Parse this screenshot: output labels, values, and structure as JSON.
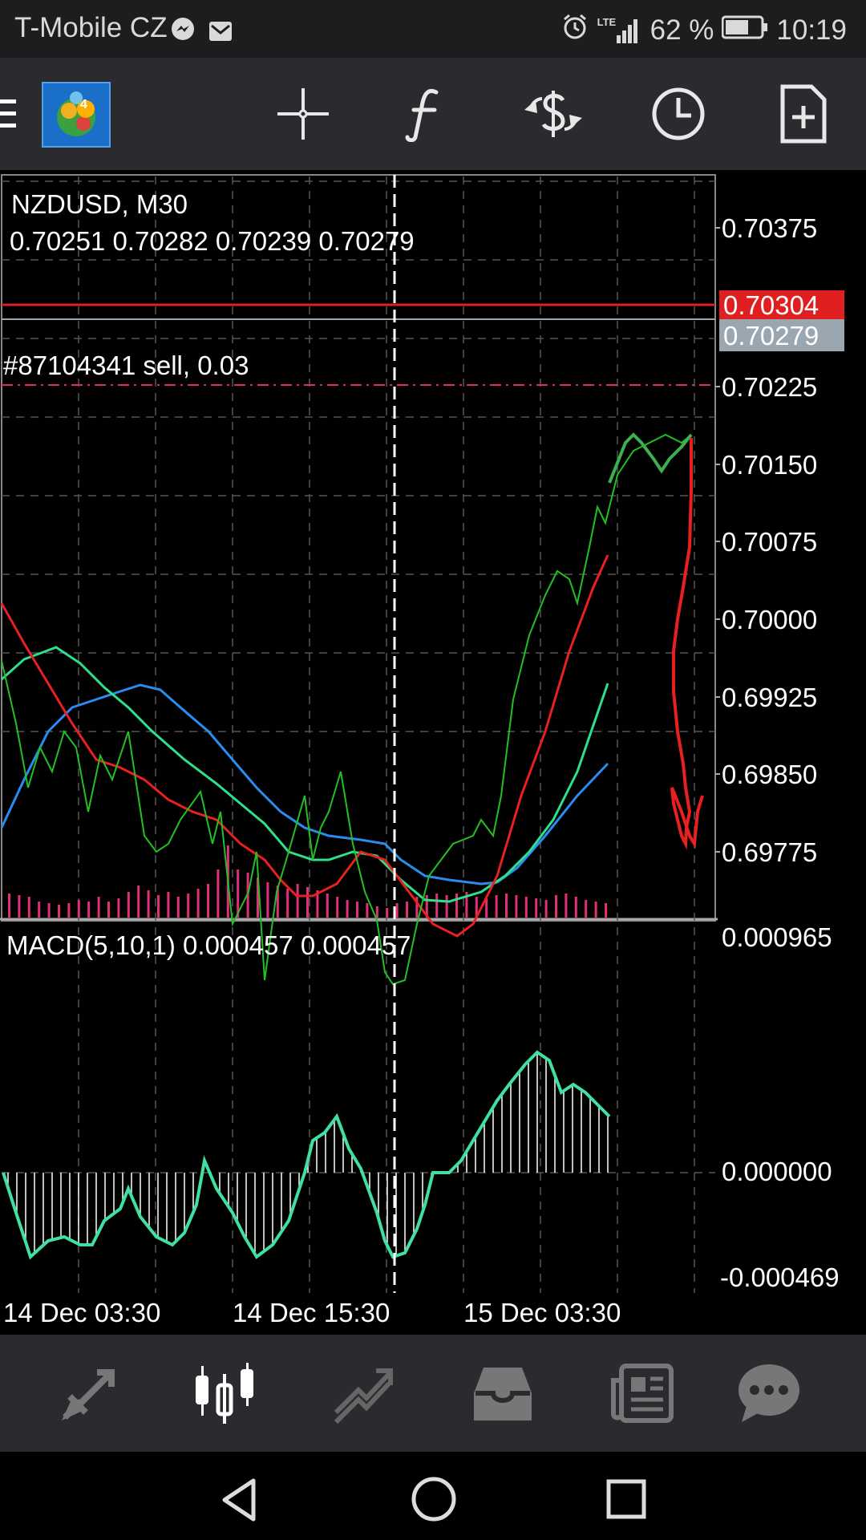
{
  "status_bar": {
    "carrier": "T-Mobile CZ",
    "battery": "62 %",
    "time": "10:19",
    "network": "LTE",
    "icons": [
      "messenger-icon",
      "mail-icon",
      "alarm-icon",
      "signal-icon",
      "battery-icon"
    ]
  },
  "toolbar": {
    "icons": [
      "menu-icon",
      "metatrader-logo",
      "crosshair-icon",
      "indicators-icon",
      "trade-icon",
      "timeframe-icon",
      "new-order-icon"
    ],
    "logo_badge": "4"
  },
  "chart": {
    "symbol_label": "NZDUSD, M30",
    "ohlc_label": "0.70251 0.70282 0.70239 0.70279",
    "order_label": "#87104341 sell, 0.03",
    "bid_tag": "0.70279",
    "ask_tag": "0.70304",
    "price_ticks": [
      "0.70375",
      "0.70225",
      "0.70150",
      "0.70075",
      "0.70000",
      "0.69925",
      "0.69850",
      "0.69775"
    ],
    "macd_label": "MACD(5,10,1) 0.000457 0.000457",
    "macd_ticks": [
      "0.000965",
      "0.000000",
      "-0.000469"
    ],
    "time_labels": [
      "14 Dec 03:30",
      "14 Dec 15:30",
      "15 Dec 03:30"
    ],
    "colors": {
      "price_line": "#22c022",
      "ma_red": "#e82020",
      "ma_green": "#2ee08a",
      "ma_blue": "#2a8cf0",
      "volume": "#e0307a",
      "macd_line": "#3fe0a0",
      "ask_line": "#e02020",
      "bid_line": "#9aa6b0"
    }
  },
  "bottom_nav": {
    "items": [
      "quotes-icon",
      "chart-icon",
      "trade-icon",
      "history-icon",
      "news-icon",
      "messages-icon"
    ],
    "active": "chart-icon"
  },
  "android_nav": {
    "items": [
      "back-icon",
      "home-icon",
      "recents-icon"
    ]
  }
}
